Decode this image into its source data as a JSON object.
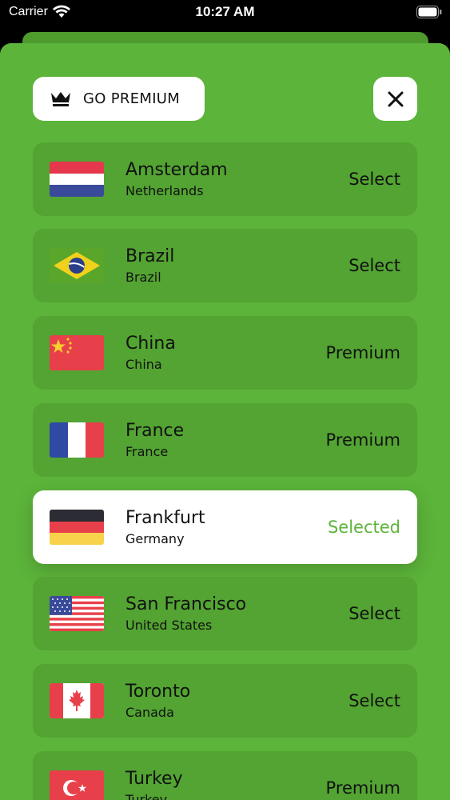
{
  "status_bar": {
    "carrier": "Carrier",
    "time": "10:27 AM"
  },
  "header": {
    "premium_label": "GO PREMIUM",
    "crown_icon": "crown-icon",
    "close_icon": "close-icon"
  },
  "colors": {
    "background": "#5cb43a",
    "row": "#53a432",
    "selected_row": "#ffffff",
    "selected_text": "#5cb43a"
  },
  "servers": [
    {
      "city": "Amsterdam",
      "country": "Netherlands",
      "status": "Select",
      "flag": "netherlands-flag-icon",
      "selected": false
    },
    {
      "city": "Brazil",
      "country": "Brazil",
      "status": "Select",
      "flag": "brazil-flag-icon",
      "selected": false
    },
    {
      "city": "China",
      "country": "China",
      "status": "Premium",
      "flag": "china-flag-icon",
      "selected": false
    },
    {
      "city": "France",
      "country": "France",
      "status": "Premium",
      "flag": "france-flag-icon",
      "selected": false
    },
    {
      "city": "Frankfurt",
      "country": "Germany",
      "status": "Selected",
      "flag": "germany-flag-icon",
      "selected": true
    },
    {
      "city": "San Francisco",
      "country": "United States",
      "status": "Select",
      "flag": "usa-flag-icon",
      "selected": false
    },
    {
      "city": "Toronto",
      "country": "Canada",
      "status": "Select",
      "flag": "canada-flag-icon",
      "selected": false
    },
    {
      "city": "Turkey",
      "country": "Turkey",
      "status": "Premium",
      "flag": "turkey-flag-icon",
      "selected": false
    }
  ]
}
